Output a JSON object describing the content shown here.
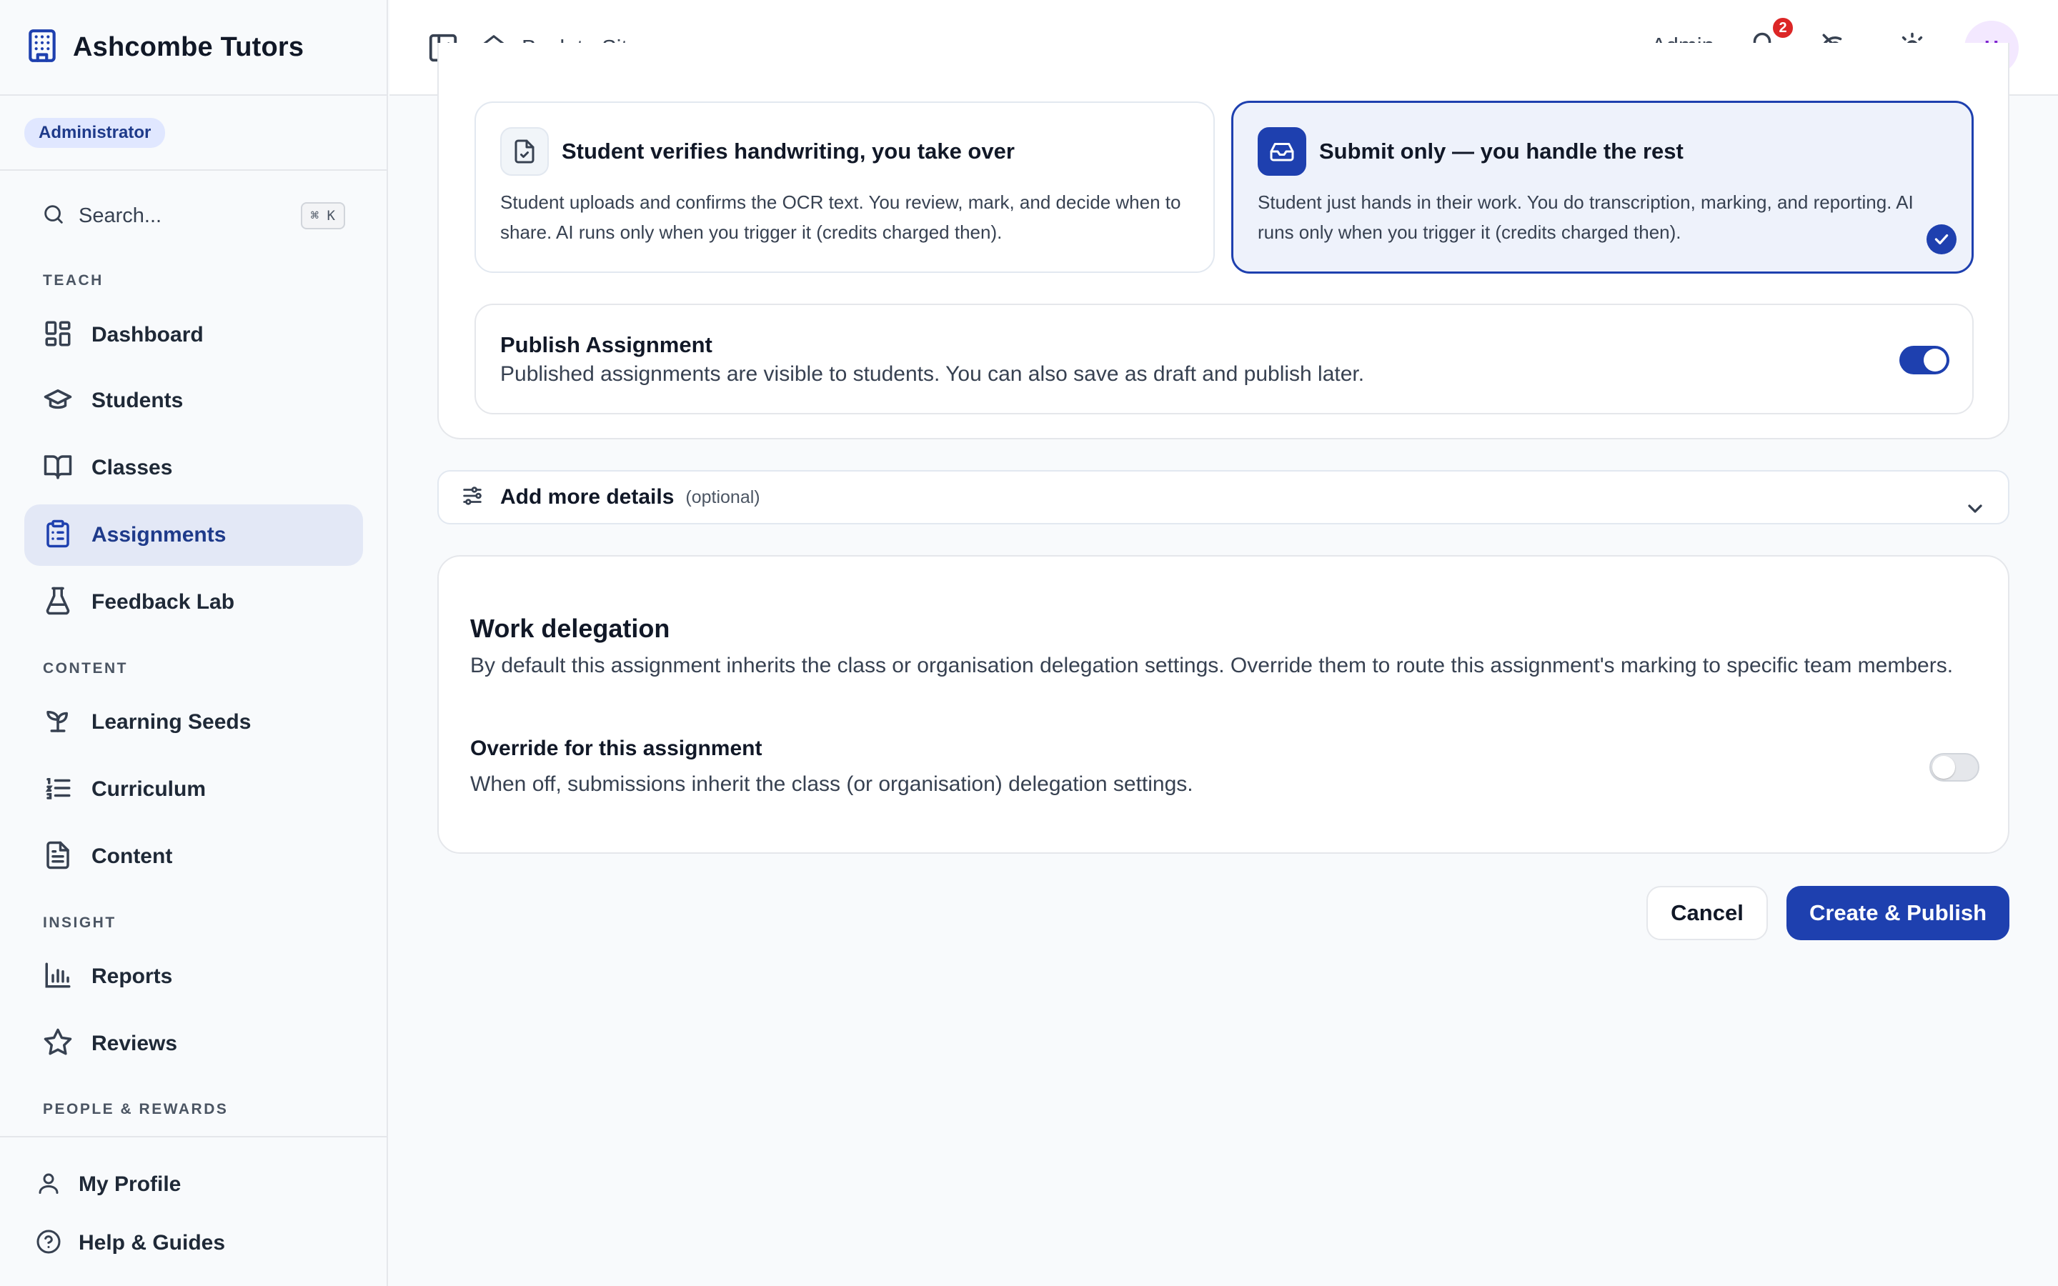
{
  "sidebar": {
    "brand": "Ashcombe Tutors",
    "role_badge": "Administrator",
    "search": {
      "label": "Search...",
      "shortcut": "⌘ K"
    },
    "sections": {
      "teach": "TEACH",
      "content": "CONTENT",
      "insight": "INSIGHT",
      "people": "PEOPLE & REWARDS"
    },
    "items": {
      "dashboard": "Dashboard",
      "students": "Students",
      "classes": "Classes",
      "assignments": "Assignments",
      "feedback_lab": "Feedback Lab",
      "learning_seeds": "Learning Seeds",
      "curriculum": "Curriculum",
      "content": "Content",
      "reports": "Reports",
      "reviews": "Reviews"
    },
    "active_item": "assignments",
    "bottom": {
      "my_profile": "My Profile",
      "help": "Help & Guides"
    }
  },
  "header": {
    "back_to_site": "Back to Site",
    "admin_label": "Admin",
    "notification_count": "2",
    "avatar_initial": "H"
  },
  "workflow_options": [
    {
      "title": "Student verifies handwriting, you take over",
      "description": "Student uploads and confirms the OCR text. You review, mark, and decide when to share. AI runs only when you trigger it (credits charged then).",
      "selected": false
    },
    {
      "title": "Submit only — you handle the rest",
      "description": "Student just hands in their work. You do transcription, marking, and reporting. AI runs only when you trigger it (credits charged then).",
      "selected": true
    }
  ],
  "publish": {
    "title": "Publish Assignment",
    "description": "Published assignments are visible to students. You can also save as draft and publish later.",
    "enabled": true
  },
  "details": {
    "title": "Add more details",
    "optional_label": "(optional)"
  },
  "delegation": {
    "title": "Work delegation",
    "description": "By default this assignment inherits the class or organisation delegation settings. Override them to route this assignment's marking to specific team members.",
    "override_title": "Override for this assignment",
    "override_description": "When off, submissions inherit the class (or organisation) delegation settings.",
    "override_enabled": false
  },
  "actions": {
    "cancel": "Cancel",
    "create_publish": "Create & Publish"
  },
  "colors": {
    "primary": "#1e40af",
    "active_nav_bg": "#e3e8f6",
    "notification": "#dc2626",
    "avatar_bg": "#f3e8ff",
    "avatar_fg": "#7e22ce"
  }
}
